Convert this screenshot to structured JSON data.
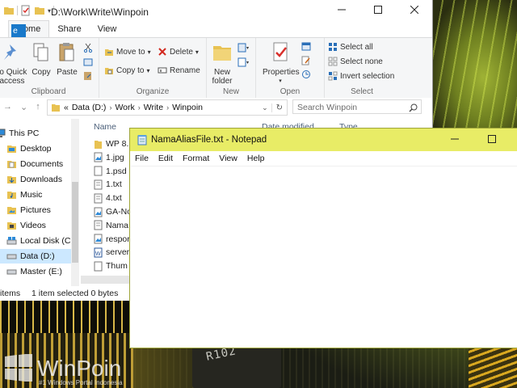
{
  "explorer": {
    "title_path": "D:\\Work\\Write\\Winpoin",
    "tabs": [
      "Home",
      "Share",
      "View"
    ],
    "ribbon": {
      "clipboard": {
        "label": "Clipboard",
        "pin": "to Quick\naccess",
        "copy": "Copy",
        "paste": "Paste"
      },
      "organize": {
        "label": "Organize",
        "move_to": "Move to",
        "copy_to": "Copy to",
        "delete": "Delete",
        "rename": "Rename"
      },
      "new": {
        "label": "New",
        "new_folder_1": "New",
        "new_folder_2": "folder"
      },
      "open": {
        "label": "Open",
        "properties": "Properties"
      },
      "select": {
        "label": "Select",
        "select_all": "Select all",
        "select_none": "Select none",
        "invert": "Invert selection"
      }
    },
    "breadcrumb": [
      "«",
      "Data (D:)",
      "Work",
      "Write",
      "Winpoin"
    ],
    "search_placeholder": "Search Winpoin",
    "nav": [
      {
        "label": "This PC",
        "icon": "computer-icon"
      },
      {
        "label": "Desktop",
        "icon": "folder-icon"
      },
      {
        "label": "Documents",
        "icon": "folder-icon"
      },
      {
        "label": "Downloads",
        "icon": "download-folder-icon"
      },
      {
        "label": "Music",
        "icon": "music-folder-icon"
      },
      {
        "label": "Pictures",
        "icon": "folder-icon"
      },
      {
        "label": "Videos",
        "icon": "folder-icon"
      },
      {
        "label": "Local Disk (C:)",
        "icon": "drive-icon"
      },
      {
        "label": "Data (D:)",
        "icon": "drive-icon"
      },
      {
        "label": "Master (E:)",
        "icon": "drive-icon"
      }
    ],
    "columns": {
      "name": "Name",
      "date": "Date modified",
      "type": "Type"
    },
    "files": [
      {
        "name": "WP 8.1",
        "icon": "folder-icon"
      },
      {
        "name": "1.jpg",
        "icon": "image-file-icon"
      },
      {
        "name": "1.psd",
        "icon": "file-icon"
      },
      {
        "name": "1.txt",
        "icon": "text-file-icon"
      },
      {
        "name": "4.txt",
        "icon": "text-file-icon"
      },
      {
        "name": "GA-No",
        "icon": "image-file-icon"
      },
      {
        "name": "Nama",
        "icon": "text-file-icon"
      },
      {
        "name": "respor",
        "icon": "image-file-icon"
      },
      {
        "name": "server.",
        "icon": "word-file-icon"
      },
      {
        "name": "Thum",
        "icon": "file-icon"
      }
    ],
    "status": {
      "items": "items",
      "selected": "1 item selected  0 bytes"
    }
  },
  "notepad": {
    "title": "NamaAliasFile.txt - Notepad",
    "menu": [
      "File",
      "Edit",
      "Format",
      "View",
      "Help"
    ],
    "content": ""
  },
  "brand": {
    "name": "WinPoin",
    "tagline": "#1 Windows Portal Indonesia"
  },
  "wallpaper_chip_text": "R102",
  "colors": {
    "accent": "#1979ca",
    "notepad_title": "#e8ec66",
    "selection": "#cce8ff"
  }
}
